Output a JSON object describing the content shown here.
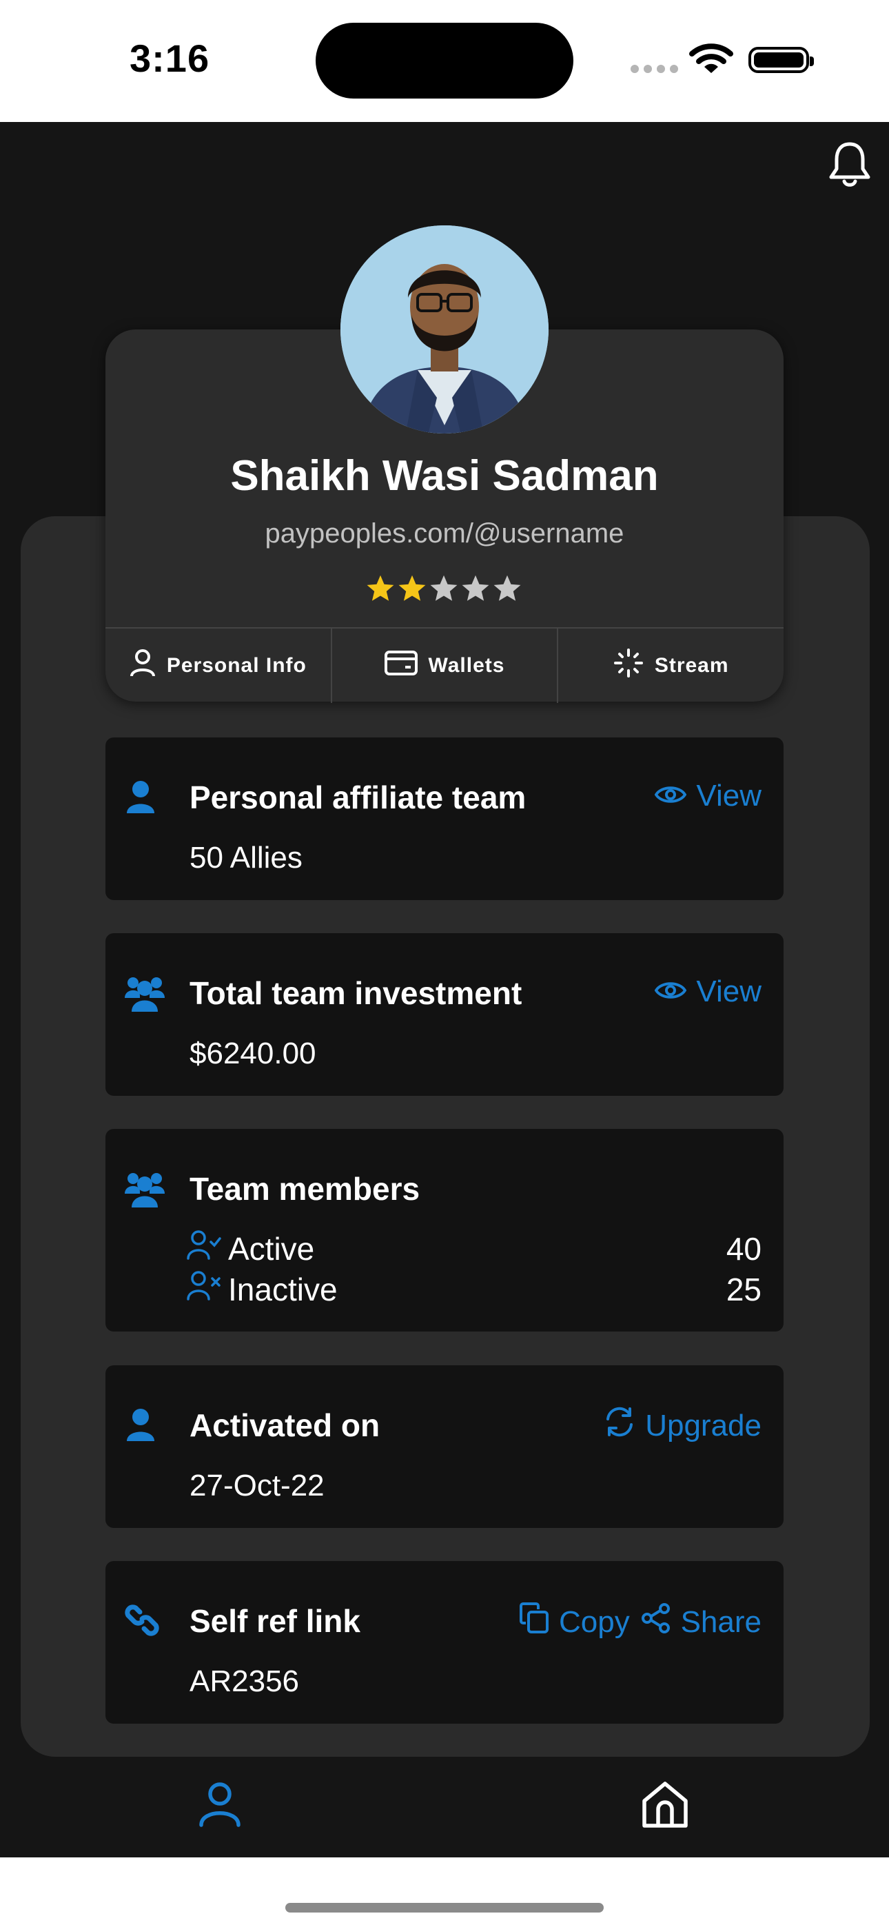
{
  "status_bar": {
    "time": "3:16"
  },
  "profile": {
    "name": "Shaikh Wasi Sadman",
    "handle": "paypeoples.com/@username",
    "rating": 2,
    "rating_max": 5,
    "tabs": [
      {
        "label": "Personal Info",
        "icon": "user-icon"
      },
      {
        "label": "Wallets",
        "icon": "wallet-icon"
      },
      {
        "label": "Stream",
        "icon": "stream-icon"
      }
    ]
  },
  "cards": {
    "affiliate": {
      "title": "Personal affiliate team",
      "value": "50 Allies",
      "action": "View"
    },
    "investment": {
      "title": "Total team investment",
      "value": "$6240.00",
      "action": "View"
    },
    "members": {
      "title": "Team members",
      "active_label": "Active",
      "active_count": "40",
      "inactive_label": "Inactive",
      "inactive_count": "25"
    },
    "activated": {
      "title": "Activated on",
      "value": "27-Oct-22",
      "action": "Upgrade"
    },
    "reflink": {
      "title": "Self ref link",
      "value": "AR2356",
      "copy": "Copy",
      "share": "Share"
    }
  },
  "colors": {
    "accent": "#1a7fd1",
    "background": "#151515",
    "panel": "#2b2b2b",
    "card": "#121212",
    "star": "#f5c518"
  }
}
